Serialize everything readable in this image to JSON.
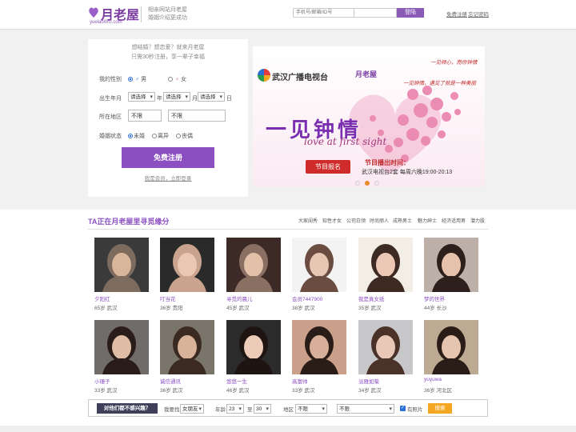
{
  "header": {
    "logo_text": "月老屋",
    "logo_sub": "yuelaoWU.com",
    "slogan_line1": "相亲网站月老屋",
    "slogan_line2": "婚姻介绍更成功",
    "phone_placeholder": "手机号/邮箱/ID号",
    "password_placeholder": "",
    "login_label": "登陆",
    "free_register": "免费注册",
    "forgot_password": "忘记密码"
  },
  "register": {
    "hint_line1": "想结婚？想恋爱？就来月老屋",
    "hint_line2": "只需30秒注册，享一辈子幸福",
    "gender_label": "我的性别",
    "gender_male": "男",
    "gender_female": "女",
    "birth_label": "出生年月",
    "birth_select": "请选择",
    "year_suffix": "年",
    "month_suffix": "月",
    "day_suffix": "日",
    "region_label": "所在地区",
    "region_value1": "不限",
    "region_value2": "不限",
    "marital_label": "婚姻状态",
    "marital_single": "未婚",
    "marital_divorced": "离异",
    "marital_widowed": "丧偶",
    "submit_label": "免费注册",
    "member_link": "我是会员，立即登录"
  },
  "promo": {
    "station": "武汉广播电视台",
    "logo": "月老屋",
    "tagline1": "一见倾心，而你钟情",
    "tagline2": "一见钟情，遇见了就是一种美丽",
    "title": "一见钟情",
    "subtitle": "love at first sight",
    "signup": "节目报名",
    "airtime_title": "节目播出时间：",
    "airtime_detail": "武汉电视台2套 每周六晚19:00-20:13"
  },
  "section": {
    "title": "TA正在月老屋里寻觅缘分",
    "tags": [
      "大家闺秀",
      "知性才女",
      "公司白领",
      "时尚丽人",
      "成熟男士",
      "魅力绅士",
      "经济适用男",
      "潜力股"
    ]
  },
  "members": [
    {
      "name": "夕阳红",
      "info": "65岁 武汉"
    },
    {
      "name": "叮当花",
      "info": "36岁 贵阳"
    },
    {
      "name": "寻觅的晨儿",
      "info": "45岁 武汉"
    },
    {
      "name": "会员7447900",
      "info": "38岁 武汉"
    },
    {
      "name": "我是真女纸",
      "info": "35岁 武汉"
    },
    {
      "name": "梦的世界",
      "info": "44岁 长沙"
    },
    {
      "name": "小珊子",
      "info": "33岁 武汉"
    },
    {
      "name": "诚信通讯",
      "info": "36岁 武汉"
    },
    {
      "name": "悠悠一生",
      "info": "46岁 武汉"
    },
    {
      "name": "高富帅",
      "info": "33岁 武汉"
    },
    {
      "name": "淡雅如菊",
      "info": "34岁 武汉"
    },
    {
      "name": "yuyuwa",
      "info": "36岁 河北区"
    }
  ],
  "search": {
    "ask": "对他们都不感兴趣？",
    "find_label": "我要找",
    "find_value": "女朋友",
    "age_label": "年龄",
    "age_from": "23",
    "age_to_label": "至",
    "age_to": "30",
    "region_label": "地区",
    "region_value1": "不限",
    "region_value2": "不限",
    "photo_label": "有照片",
    "go_label": "搜索"
  },
  "colors": {
    "brand": "#8b4fc2",
    "accent": "#f5a623"
  }
}
